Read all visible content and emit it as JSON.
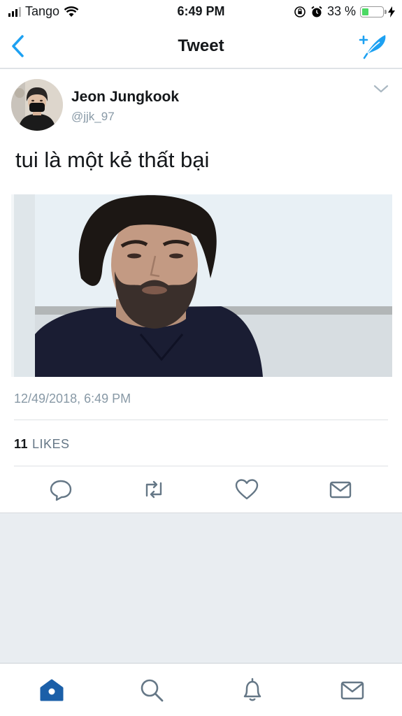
{
  "status_bar": {
    "carrier": "Tango",
    "time": "6:49 PM",
    "battery_percent": "33 %",
    "battery_level": 0.33,
    "icons": [
      "signal-icon",
      "wifi-icon",
      "orientation-lock-icon",
      "alarm-icon",
      "battery-icon",
      "charging-bolt-icon"
    ]
  },
  "nav": {
    "title": "Tweet",
    "back_icon": "chevron-left-icon",
    "compose_icon": "compose-tweet-icon"
  },
  "tweet": {
    "author_name": "Jeon Jungkook",
    "author_handle": "@jjk_97",
    "text": "tui là một kẻ thất bại",
    "timestamp": "12/49/2018, 6:49 PM",
    "likes_count": "11",
    "likes_label": "LIKES",
    "menu_icon": "chevron-down-icon",
    "actions": [
      "reply-icon",
      "retweet-icon",
      "like-icon",
      "direct-message-icon"
    ]
  },
  "tab_bar": {
    "items": [
      "home-icon",
      "search-icon",
      "notifications-icon",
      "messages-icon"
    ],
    "active": "home-icon"
  },
  "colors": {
    "accent": "#1da1f2",
    "active_tab": "#1b5fa8",
    "secondary_text": "#8899a6",
    "icon_gray": "#657786"
  }
}
